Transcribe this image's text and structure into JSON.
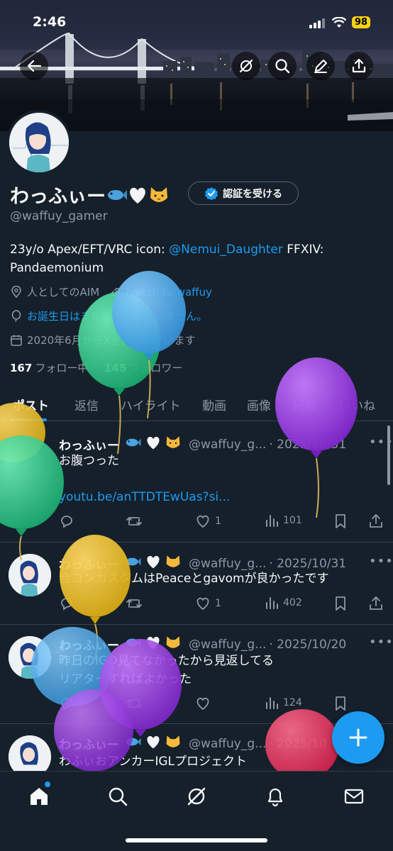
{
  "status_bar": {
    "time": "2:46",
    "battery": "98"
  },
  "header_buttons": {
    "back": "arrow-left-icon",
    "grok": "grok-icon",
    "search": "search-icon",
    "edit": "pencil-icon",
    "share": "share-icon"
  },
  "profile": {
    "display_name": "わっふぃー",
    "handle": "@waffuy_gamer",
    "verify_button": "認証を受ける",
    "bio_prefix": "23y/o Apex/EFT/VRC icon: ",
    "bio_mention": "@Nemui_Daughter",
    "bio_suffix": " FFXIV:",
    "bio_line2": "Pandaemonium",
    "location": "人としてのAIM",
    "website": "twitch.tv/waffuy",
    "birthday": "お誕生日はまだ設定されていません。",
    "joined": "2020年6月からXを利用しています",
    "following_count": "167",
    "following_label": "フォロー中",
    "followers_count": "145",
    "followers_label": "フォロワー"
  },
  "tabs": [
    "ポスト",
    "返信",
    "ハイライト",
    "動画",
    "画像",
    "記事",
    "いいね"
  ],
  "posts": [
    {
      "name": "わっふぃー",
      "handle": "@waffuy_g...",
      "date": "· 2025/10/31",
      "text": "お腹つった",
      "link": "youtu.be/anTTDTEwUas?si...",
      "replies": "",
      "retweets": "",
      "likes": "1",
      "views": "101"
    },
    {
      "name": "わっふぃー",
      "handle": "@waffuy_g...",
      "date": "· 2025/10/31",
      "text": "合コンカスタムはPeaceとgavomが良かったです",
      "replies": "",
      "retweets": "",
      "likes": "1",
      "views": "402"
    },
    {
      "name": "わっふぃー",
      "handle": "@waffuy_g...",
      "date": "· 2025/10/20",
      "text": "昨日のIGO見てなかったから見返してる",
      "text2": "リアタイすればよかった",
      "likes": "",
      "views": "124"
    },
    {
      "name": "わっふぃー",
      "handle": "@waffuy_g...",
      "date": "· 2025/10",
      "text": "わふぃおアンカーIGLプロジェクト"
    }
  ],
  "colors": {
    "background": "#15202b",
    "accent": "#1d9bf0",
    "muted_text": "#8b98a5",
    "divider": "#38444d"
  },
  "bottom_nav": [
    "home-icon",
    "search-icon",
    "grok-icon",
    "bell-icon",
    "mail-icon"
  ],
  "fab_icon": "plus-icon"
}
